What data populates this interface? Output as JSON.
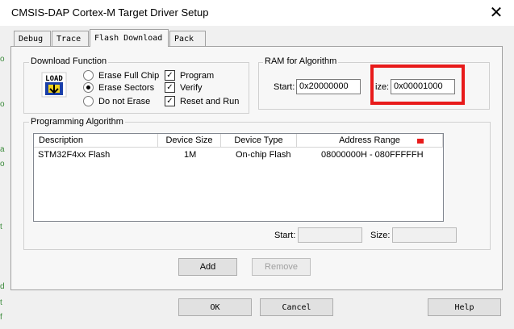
{
  "window": {
    "title": "CMSIS-DAP Cortex-M Target Driver Setup",
    "close_glyph": "✕"
  },
  "tabs": [
    {
      "label": "Debug",
      "active": false
    },
    {
      "label": "Trace",
      "active": false
    },
    {
      "label": "Flash Download",
      "active": true
    },
    {
      "label": "Pack",
      "active": false
    }
  ],
  "download_function": {
    "legend": "Download Function",
    "icon_text": "LOAD",
    "radios": [
      {
        "label": "Erase Full Chip",
        "selected": false
      },
      {
        "label": "Erase Sectors",
        "selected": true
      },
      {
        "label": "Do not Erase",
        "selected": false
      }
    ],
    "checkboxes": [
      {
        "label": "Program",
        "checked": true
      },
      {
        "label": "Verify",
        "checked": true
      },
      {
        "label": "Reset and Run",
        "checked": true
      }
    ]
  },
  "ram": {
    "legend": "RAM for Algorithm",
    "start_label": "Start:",
    "start_value": "0x20000000",
    "size_label": "ize:",
    "size_value": "0x00001000",
    "highlight_color": "#e81b1b"
  },
  "programming": {
    "legend": "Programming Algorithm",
    "columns": [
      "Description",
      "Device Size",
      "Device Type",
      "Address Range"
    ],
    "rows": [
      {
        "description": "STM32F4xx Flash",
        "size": "1M",
        "type": "On-chip Flash",
        "range": "08000000H - 080FFFFFH"
      }
    ],
    "start_label": "Start:",
    "start_value": "",
    "size_label": "Size:",
    "size_value": "",
    "add_label": "Add",
    "remove_label": "Remove"
  },
  "footer": {
    "ok_label": "OK",
    "cancel_label": "Cancel",
    "help_label": "Help"
  },
  "background_text": [
    "o",
    "o",
    "a",
    "o",
    "t",
    "d",
    "t",
    "f"
  ]
}
